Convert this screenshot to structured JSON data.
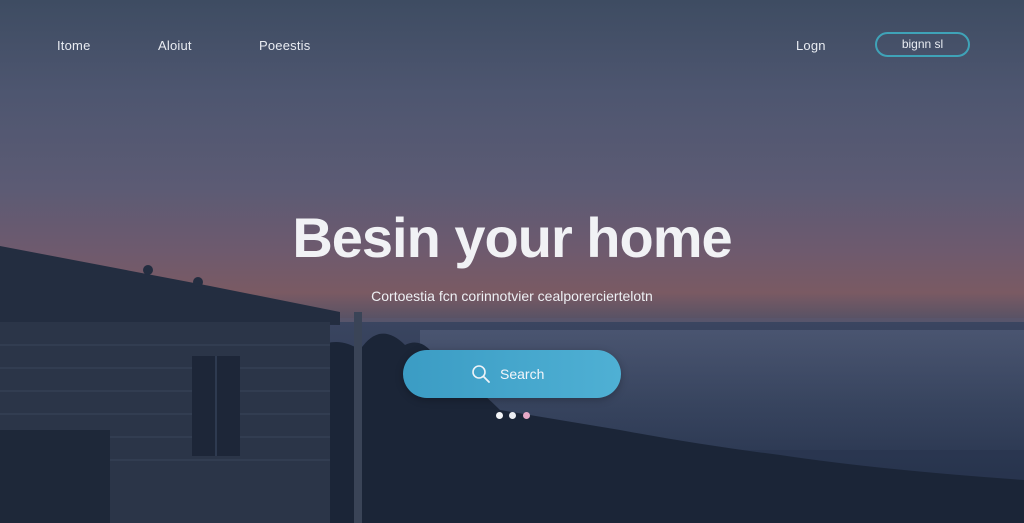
{
  "nav": {
    "items": [
      {
        "label": "Itome"
      },
      {
        "label": "Aloiut"
      },
      {
        "label": "Poeestis"
      }
    ],
    "login_label": "Logn",
    "signup_label": "bignn sl"
  },
  "hero": {
    "title": "Besin your home",
    "subtitle": "Cortoestia fcn corinnotvier cealporerciertelotn",
    "search_label": "Search"
  },
  "carousel": {
    "dots": [
      {
        "active": true
      },
      {
        "active": false
      },
      {
        "active": false
      }
    ]
  },
  "colors": {
    "accent": "#4aa8cc",
    "signup_border": "#3fa3b8",
    "dot_highlight": "#e7a9c8"
  }
}
